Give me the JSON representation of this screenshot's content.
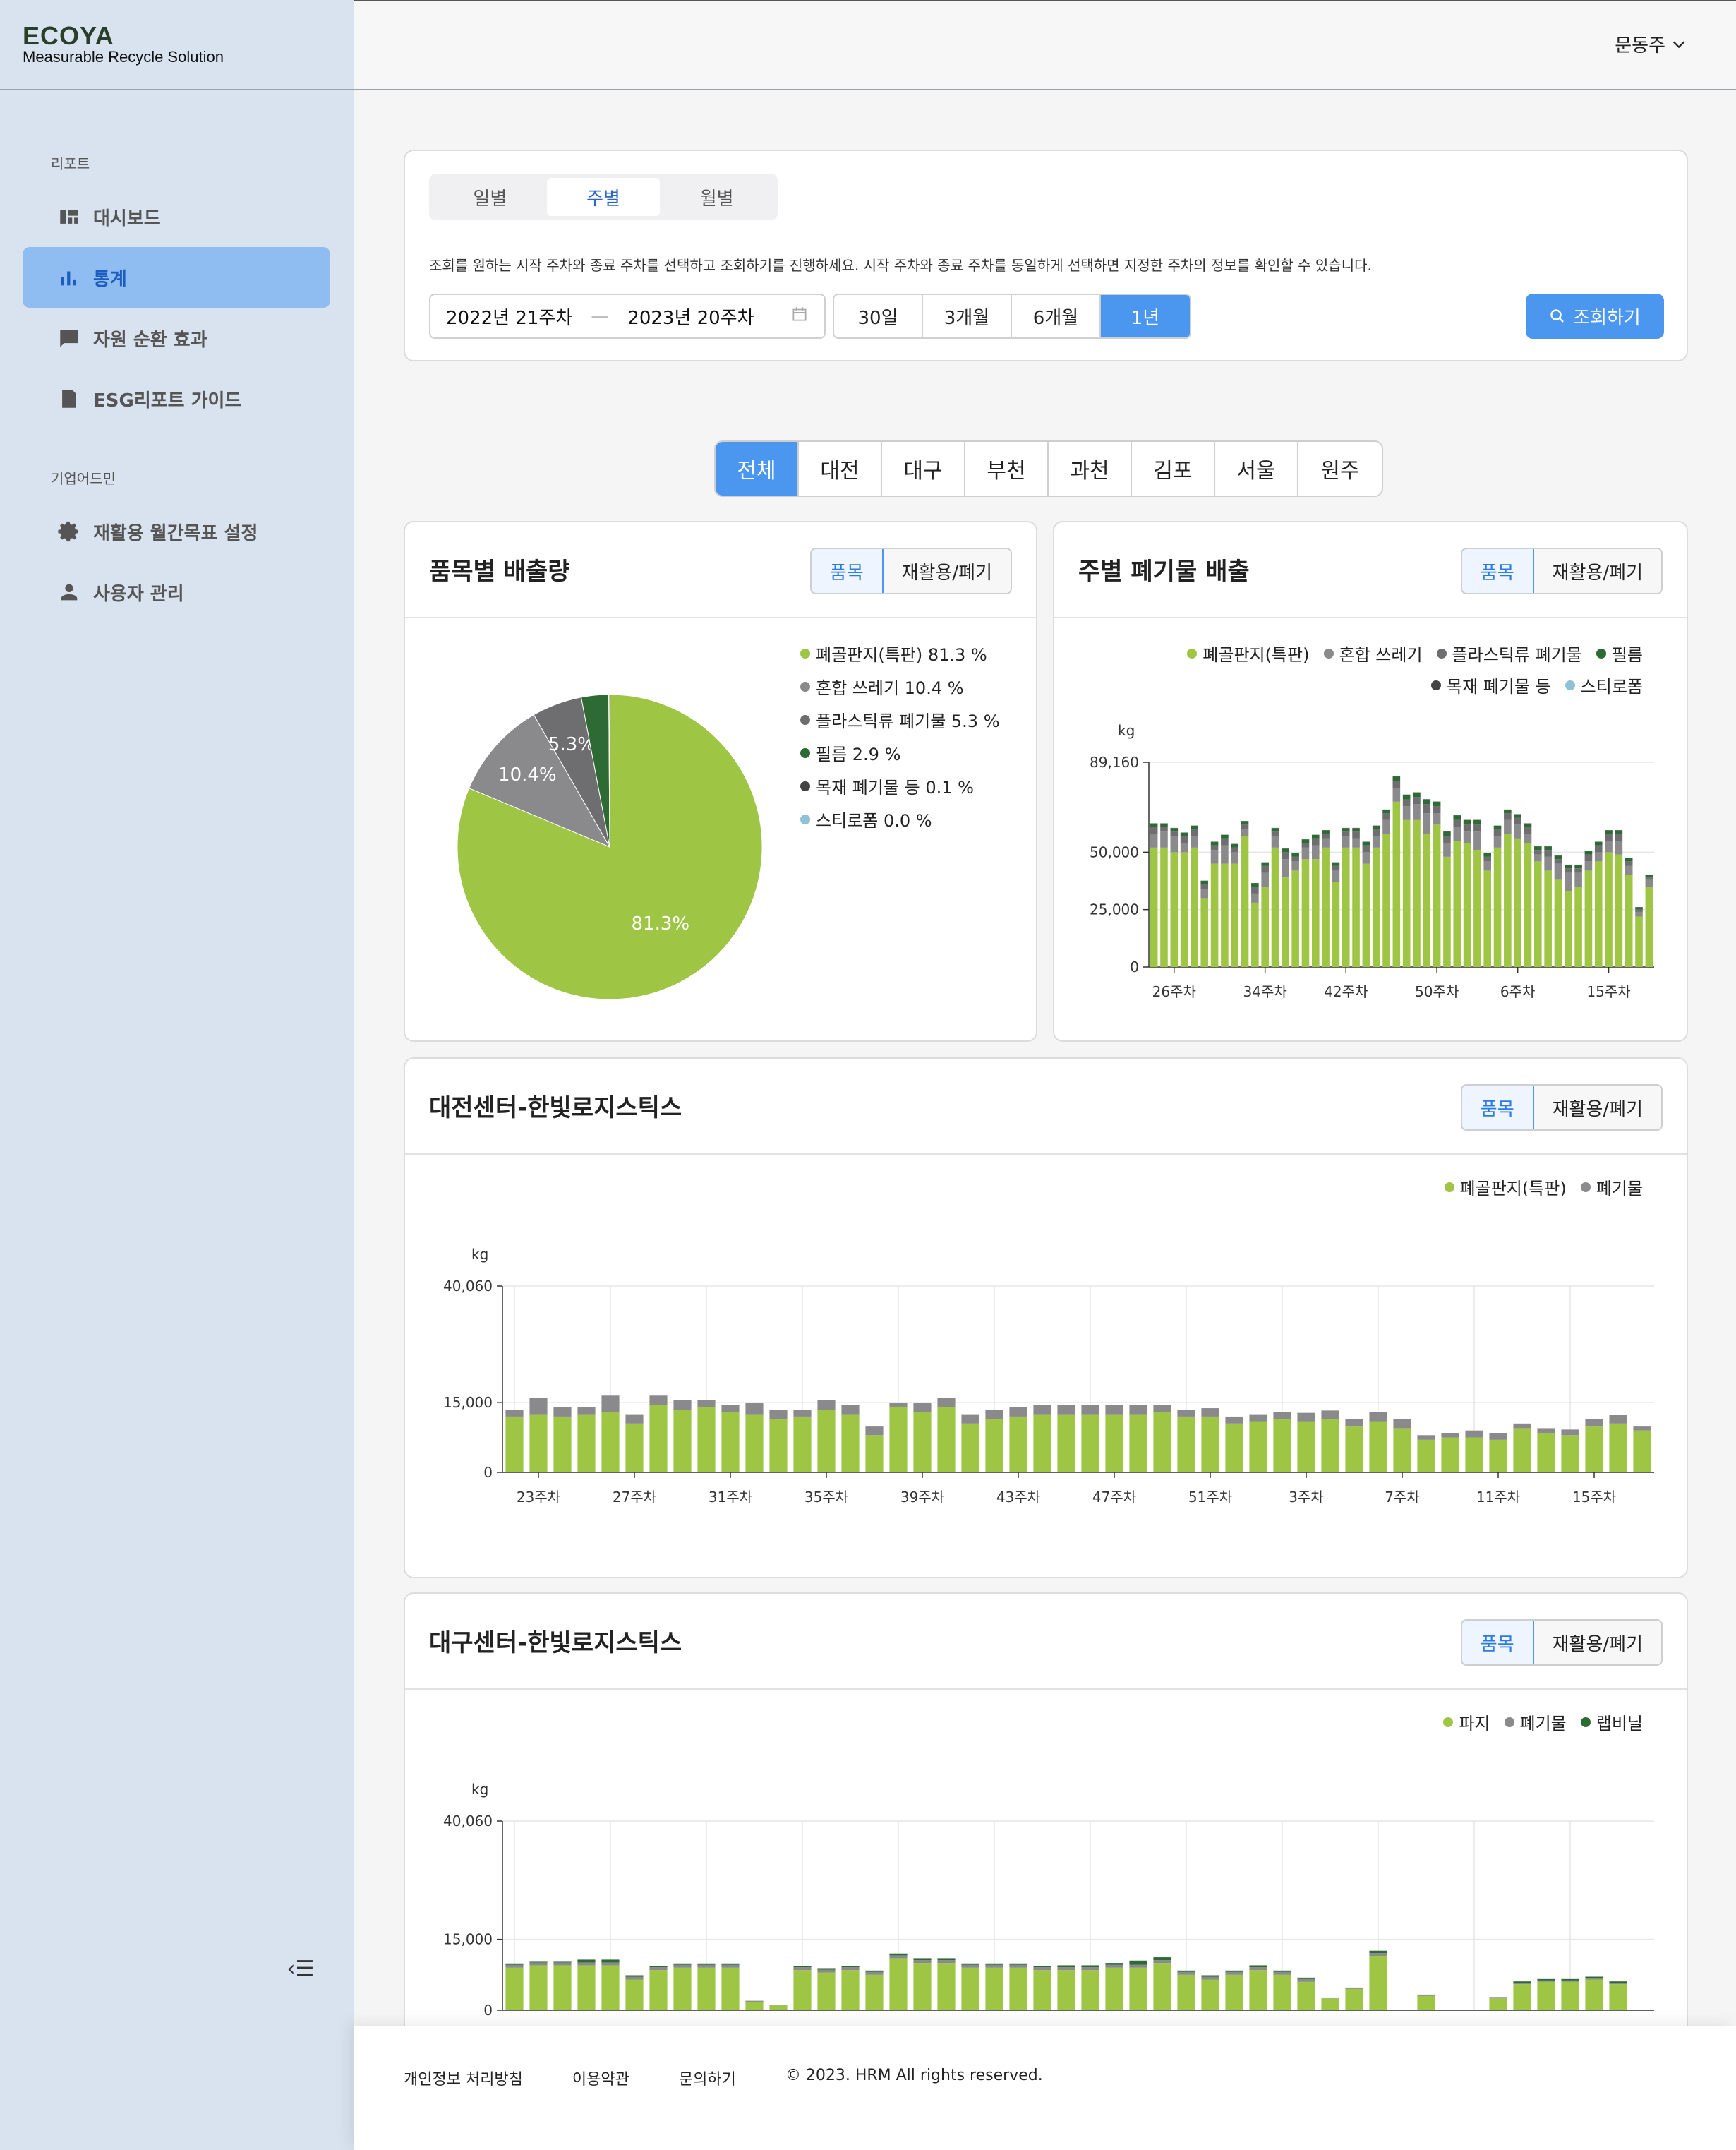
{
  "brand": {
    "logo": "ECOYA",
    "tagline": "Measurable Recycle Solution"
  },
  "sidebar": {
    "section_report": "리포트",
    "section_admin": "기업어드민",
    "items": [
      {
        "label": "대시보드",
        "icon": "dashboard-icon"
      },
      {
        "label": "통계",
        "icon": "bar-chart-icon",
        "active": true
      },
      {
        "label": "자원 순환 효과",
        "icon": "comment-icon"
      },
      {
        "label": "ESG리포트 가이드",
        "icon": "document-icon"
      },
      {
        "label": "재활용 월간목표 설정",
        "icon": "gear-icon"
      },
      {
        "label": "사용자 관리",
        "icon": "person-icon"
      }
    ]
  },
  "header": {
    "user": "문동주"
  },
  "filter": {
    "tabs": [
      "일별",
      "주별",
      "월별"
    ],
    "active_tab": "주별",
    "description": "조회를 원하는 시작 주차와 종료 주차를 선택하고 조회하기를 진행하세요. 시작 주차와 종료 주차를 동일하게 선택하면 지정한 주차의 정보를 확인할 수 있습니다.",
    "start": "2022년 21주차",
    "end": "2023년 20주차",
    "periods": [
      "30일",
      "3개월",
      "6개월",
      "1년"
    ],
    "active_period": "1년",
    "search_label": "조회하기"
  },
  "regions": [
    "전체",
    "대전",
    "대구",
    "부천",
    "과천",
    "김포",
    "서울",
    "원주"
  ],
  "active_region": "전체",
  "toggle": {
    "item": "품목",
    "recycle": "재활용/폐기"
  },
  "cards": {
    "pie": {
      "title": "품목별 배출량"
    },
    "weekly": {
      "title": "주별 폐기물 배출"
    },
    "daejeon": {
      "title": "대전센터-한빛로지스틱스"
    },
    "daegu": {
      "title": "대구센터-한빛로지스틱스"
    }
  },
  "colors": {
    "green": "#9ec544",
    "gray": "#8a8a8d",
    "darkgray": "#6e6e70",
    "darkgreen": "#2e6b34",
    "black": "#444444",
    "lightblue": "#8fc2d6",
    "accent": "#4b96ee"
  },
  "chart_data": [
    {
      "type": "pie",
      "title": "품목별 배출량",
      "labels": [
        "폐골판지(특판)",
        "혼합 쓰레기",
        "플라스틱류 폐기물",
        "필름",
        "목재 폐기물 등",
        "스티로폼"
      ],
      "values": [
        81.3,
        10.4,
        5.3,
        2.9,
        0.1,
        0.0
      ],
      "legend": [
        "폐골판지(특판) 81.3 %",
        "혼합 쓰레기 10.4 %",
        "플라스틱류 폐기물 5.3 %",
        "필름 2.9 %",
        "목재 폐기물 등 0.1 %",
        "스티로폼 0.0 %"
      ],
      "slice_labels": [
        "81.3%",
        "10.4%",
        "5.3%"
      ]
    },
    {
      "type": "bar",
      "title": "주별 폐기물 배출",
      "ylabel": "kg",
      "ylim": [
        0,
        89160
      ],
      "yticks": [
        "0",
        "25,000",
        "50,000",
        "89,160"
      ],
      "xtick_labels": [
        "26주차",
        "34주차",
        "42주차",
        "50주차",
        "6주차",
        "15주차"
      ],
      "series": [
        {
          "name": "폐골판지(특판)",
          "values": [
            52000,
            52000,
            50000,
            50000,
            52000,
            30000,
            45000,
            45000,
            45000,
            57000,
            28000,
            35000,
            52000,
            39000,
            42000,
            47000,
            47000,
            52000,
            37000,
            52000,
            52000,
            45000,
            52000,
            58000,
            72000,
            64000,
            64000,
            58000,
            62000,
            48000,
            55000,
            54000,
            51000,
            42000,
            52000,
            58000,
            56000,
            54000,
            46000,
            42000,
            38000,
            33000,
            35000,
            42000,
            46000,
            50000,
            49000,
            40000,
            22000,
            35000
          ]
        },
        {
          "name": "혼합 쓰레기",
          "values": [
            6000,
            7000,
            7000,
            4000,
            5000,
            4000,
            6000,
            8000,
            5000,
            3000,
            4000,
            6000,
            5000,
            8000,
            4000,
            5000,
            6000,
            4000,
            5000,
            5000,
            4000,
            5000,
            5000,
            6000,
            6000,
            6000,
            7000,
            9000,
            5000,
            6000,
            6000,
            5000,
            8000,
            4000,
            5000,
            6000,
            6000,
            4000,
            3000,
            6000,
            7000,
            8000,
            6000,
            4000,
            4000,
            5000,
            6000,
            4000,
            2000,
            3000
          ]
        },
        {
          "name": "플라스틱류 폐기물",
          "values": [
            3000,
            2000,
            2000,
            3000,
            3000,
            2000,
            2000,
            3000,
            2000,
            2000,
            3000,
            3000,
            2000,
            3000,
            2000,
            2000,
            3000,
            2000,
            2000,
            2000,
            3000,
            3000,
            3000,
            3000,
            3000,
            3000,
            3000,
            4000,
            3000,
            3000,
            3000,
            3000,
            3000,
            2000,
            3000,
            3000,
            3000,
            3000,
            2000,
            3000,
            2000,
            2000,
            2000,
            3000,
            3000,
            3000,
            3000,
            2000,
            1000,
            1000
          ]
        },
        {
          "name": "필름",
          "values": [
            1500,
            1500,
            1500,
            1500,
            1500,
            1500,
            1500,
            1500,
            1500,
            1500,
            1500,
            1500,
            1500,
            1500,
            1500,
            1500,
            1500,
            1500,
            1500,
            1500,
            1500,
            1500,
            1500,
            1500,
            2000,
            2000,
            2000,
            2000,
            2000,
            2000,
            2000,
            2000,
            2000,
            1500,
            1500,
            1500,
            1500,
            1500,
            1500,
            1500,
            1500,
            1500,
            1500,
            1500,
            1500,
            1500,
            1500,
            1500,
            1000,
            1000
          ]
        },
        {
          "name": "목재 폐기물 등",
          "values": [
            100,
            100,
            100,
            100,
            100,
            100,
            100,
            100,
            100,
            100,
            100,
            100,
            100,
            100,
            100,
            100,
            100,
            100,
            100,
            100,
            100,
            100,
            100,
            100,
            100,
            100,
            100,
            100,
            100,
            100,
            100,
            100,
            100,
            100,
            100,
            100,
            100,
            100,
            100,
            100,
            100,
            100,
            100,
            100,
            100,
            100,
            100,
            100,
            100,
            100
          ]
        },
        {
          "name": "스티로폼",
          "values": [
            0,
            0,
            0,
            0,
            0,
            0,
            0,
            0,
            0,
            0,
            0,
            0,
            0,
            0,
            0,
            0,
            0,
            0,
            0,
            0,
            0,
            0,
            0,
            0,
            0,
            0,
            0,
            0,
            0,
            0,
            0,
            0,
            0,
            0,
            0,
            0,
            0,
            0,
            0,
            0,
            0,
            0,
            0,
            0,
            0,
            0,
            0,
            0,
            0,
            0
          ]
        }
      ]
    },
    {
      "type": "bar",
      "title": "대전센터-한빛로지스틱스",
      "ylabel": "kg",
      "ylim": [
        0,
        40060
      ],
      "yticks": [
        "0",
        "15,000",
        "40,060"
      ],
      "xtick_labels": [
        "23주차",
        "27주차",
        "31주차",
        "35주차",
        "39주차",
        "43주차",
        "47주차",
        "51주차",
        "3주차",
        "7주차",
        "11주차",
        "15주차"
      ],
      "series": [
        {
          "name": "폐골판지(특판)",
          "values": [
            12000,
            12500,
            12000,
            12500,
            13000,
            10500,
            14500,
            13500,
            14000,
            13000,
            12500,
            11500,
            12000,
            13500,
            12500,
            8000,
            14000,
            13000,
            14000,
            10500,
            11500,
            12000,
            12500,
            12500,
            12500,
            12500,
            12500,
            13000,
            12000,
            12000,
            10500,
            11000,
            11500,
            11000,
            11500,
            10000,
            11000,
            9500,
            7000,
            7500,
            7500,
            7000,
            9500,
            8500,
            8000,
            10000,
            10500,
            9000
          ]
        },
        {
          "name": "폐기물",
          "values": [
            1500,
            3500,
            2000,
            1500,
            3500,
            2000,
            2000,
            2000,
            1500,
            1500,
            2500,
            2000,
            1500,
            2000,
            2000,
            2000,
            1000,
            2000,
            2000,
            2000,
            2000,
            2000,
            2000,
            2000,
            2000,
            2000,
            2000,
            1500,
            1500,
            1800,
            1500,
            1500,
            1500,
            1800,
            1800,
            1500,
            2000,
            2000,
            1000,
            1000,
            1500,
            1500,
            1000,
            1000,
            1200,
            1500,
            1800,
            1000
          ]
        }
      ]
    },
    {
      "type": "bar",
      "title": "대구센터-한빛로지스틱스",
      "ylabel": "kg",
      "ylim": [
        0,
        40060
      ],
      "yticks": [
        "0",
        "15,000",
        "40,060"
      ],
      "series": [
        {
          "name": "파지",
          "values": [
            9000,
            9500,
            9500,
            9500,
            9500,
            6500,
            8500,
            9000,
            9000,
            9000,
            1800,
            1000,
            8500,
            8000,
            8500,
            7500,
            11000,
            10000,
            10000,
            9000,
            9000,
            9000,
            8500,
            8500,
            8500,
            9000,
            9000,
            10000,
            7500,
            6500,
            7500,
            8500,
            7500,
            6000,
            2500,
            4500,
            11500,
            0,
            3000,
            0,
            0,
            2500,
            5500,
            6000,
            6000,
            6500,
            5500,
            0
          ]
        },
        {
          "name": "폐기물",
          "values": [
            600,
            600,
            600,
            600,
            600,
            600,
            600,
            600,
            600,
            600,
            200,
            100,
            600,
            600,
            600,
            600,
            600,
            600,
            600,
            600,
            600,
            600,
            600,
            600,
            600,
            600,
            600,
            600,
            600,
            600,
            600,
            600,
            600,
            600,
            200,
            300,
            600,
            0,
            300,
            0,
            0,
            300,
            300,
            300,
            300,
            300,
            300,
            0
          ]
        },
        {
          "name": "랩비닐",
          "values": [
            300,
            300,
            300,
            600,
            600,
            300,
            300,
            300,
            300,
            300,
            0,
            0,
            300,
            300,
            300,
            300,
            400,
            400,
            400,
            300,
            300,
            300,
            300,
            400,
            400,
            400,
            900,
            600,
            300,
            300,
            300,
            400,
            300,
            300,
            0,
            0,
            500,
            0,
            0,
            0,
            0,
            0,
            300,
            300,
            300,
            300,
            300,
            0
          ]
        }
      ]
    }
  ],
  "legends": {
    "weekly": [
      "폐골판지(특판)",
      "혼합 쓰레기",
      "플라스틱류 폐기물",
      "필름",
      "목재 폐기물 등",
      "스티로폼"
    ],
    "daejeon": [
      "폐골판지(특판)",
      "폐기물"
    ],
    "daegu": [
      "파지",
      "폐기물",
      "랩비닐"
    ]
  },
  "footer": {
    "privacy": "개인정보 처리방침",
    "terms": "이용약관",
    "contact": "문의하기",
    "copyright": "© 2023. HRM All rights reserved."
  }
}
